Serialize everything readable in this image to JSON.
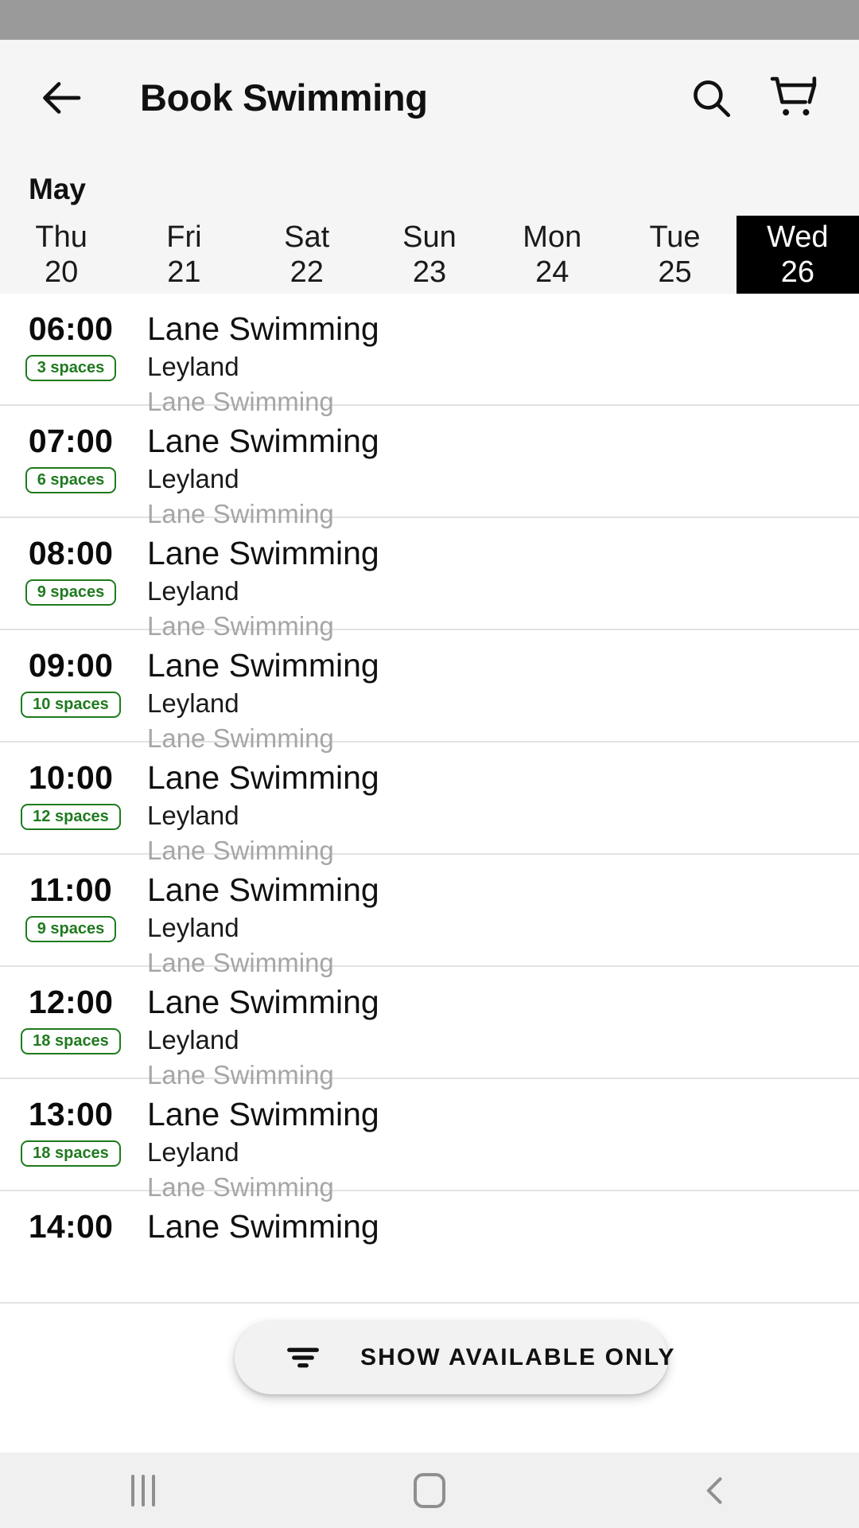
{
  "status_bar": {
    "background": "#9a9a9a"
  },
  "app_bar": {
    "title": "Book Swimming",
    "back_icon": "arrow-left-icon",
    "search_icon": "search-icon",
    "cart_icon": "shopping-cart-icon"
  },
  "calendar": {
    "month": "May",
    "days": [
      {
        "dow": "Thu",
        "dom": "20",
        "selected": false
      },
      {
        "dow": "Fri",
        "dom": "21",
        "selected": false
      },
      {
        "dow": "Sat",
        "dom": "22",
        "selected": false
      },
      {
        "dow": "Sun",
        "dom": "23",
        "selected": false
      },
      {
        "dow": "Mon",
        "dom": "24",
        "selected": false
      },
      {
        "dow": "Tue",
        "dom": "25",
        "selected": false
      },
      {
        "dow": "Wed",
        "dom": "26",
        "selected": true
      }
    ],
    "selected_background": "#000000",
    "selected_text_color": "#ffffff"
  },
  "sessions": [
    {
      "time": "06:00",
      "spaces": "3 spaces",
      "name": "Lane Swimming",
      "venue": "Leyland",
      "sub": "Lane Swimming"
    },
    {
      "time": "07:00",
      "spaces": "6 spaces",
      "name": "Lane Swimming",
      "venue": "Leyland",
      "sub": "Lane Swimming"
    },
    {
      "time": "08:00",
      "spaces": "9 spaces",
      "name": "Lane Swimming",
      "venue": "Leyland",
      "sub": "Lane Swimming"
    },
    {
      "time": "09:00",
      "spaces": "10 spaces",
      "name": "Lane Swimming",
      "venue": "Leyland",
      "sub": "Lane Swimming"
    },
    {
      "time": "10:00",
      "spaces": "12 spaces",
      "name": "Lane Swimming",
      "venue": "Leyland",
      "sub": "Lane Swimming"
    },
    {
      "time": "11:00",
      "spaces": "9 spaces",
      "name": "Lane Swimming",
      "venue": "Leyland",
      "sub": "Lane Swimming"
    },
    {
      "time": "12:00",
      "spaces": "18 spaces",
      "name": "Lane Swimming",
      "venue": "Leyland",
      "sub": "Lane Swimming"
    },
    {
      "time": "13:00",
      "spaces": "18 spaces",
      "name": "Lane Swimming",
      "venue": "Leyland",
      "sub": "Lane Swimming"
    },
    {
      "time": "14:00",
      "spaces": "",
      "name": "Lane Swimming",
      "venue": "",
      "sub": ""
    }
  ],
  "badge_color": "#1f7a1f",
  "filter_button": {
    "label": "SHOW AVAILABLE ONLY",
    "icon": "filter-icon"
  },
  "nav_bar": {
    "recents_icon": "recents-icon",
    "home_icon": "home-icon",
    "back_icon": "chevron-left-icon"
  }
}
